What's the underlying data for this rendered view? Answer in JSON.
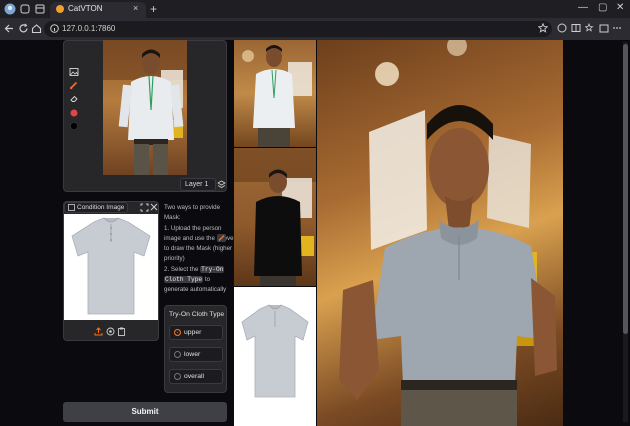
{
  "browser": {
    "tab_title": "CatVTON",
    "url": "127.0.0.1:7860",
    "tab_close": "×",
    "new_tab": "+",
    "window_controls": {
      "minimize": "—",
      "maximize": "▢",
      "close": "✕"
    }
  },
  "editor": {
    "layer_button_label": "Layer 1",
    "tools": [
      "image-icon",
      "brush-icon",
      "eraser-icon",
      "color-icon",
      "size-icon"
    ]
  },
  "condition_image": {
    "label": "Condition Image",
    "controls": [
      "fullscreen-icon",
      "close-icon"
    ],
    "bottom_actions": [
      "upload-icon",
      "camera-icon",
      "clipboard-icon"
    ]
  },
  "instructions": {
    "intro": "Two ways to provide Mask:",
    "step1_a": "1. Upload the person image and use the",
    "step1_b": "above to draw the Mask (higher priority)",
    "step2_a": "2. Select the",
    "code_try_on": "Try-On",
    "code_cloth_type": "Cloth Type",
    "step2_b": "to generate automatically"
  },
  "cloth_type": {
    "title": "Try-On Cloth Type",
    "options": [
      {
        "label": "upper",
        "selected": true
      },
      {
        "label": "lower",
        "selected": false
      },
      {
        "label": "overall",
        "selected": false
      }
    ]
  },
  "submit_label": "Submit",
  "colors": {
    "accent": "#f97316",
    "page_bg": "#0b0b0f",
    "panel_bg": "#27272a"
  }
}
